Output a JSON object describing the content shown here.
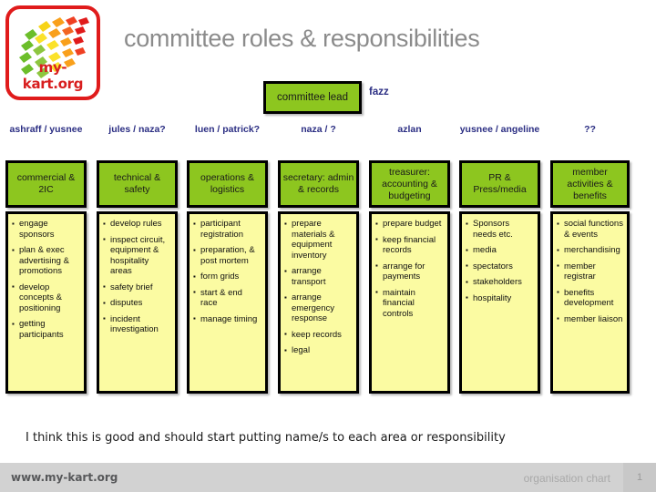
{
  "brand": {
    "logo_text": "my-kart.org",
    "logo_icon": "checkered-flag-icon",
    "border_color": "#e01b1b"
  },
  "header": {
    "title": "committee roles & responsibilities",
    "title_color": "#8b8b8b"
  },
  "lead": {
    "label": "committee lead",
    "owner": "fazz",
    "box_color": "#8dc61f"
  },
  "colors": {
    "role_green": "#8dc61f",
    "tasks_yellow": "#fbfba2",
    "name_blue": "#2b2e83",
    "footer_gray": "#d2d2d2"
  },
  "columns": [
    {
      "owner": "ashraff / yusnee",
      "role": "commercial & 2IC",
      "tasks": [
        "engage sponsors",
        "plan & exec advertising & promotions",
        "develop concepts & positioning",
        "getting participants"
      ]
    },
    {
      "owner": "jules / naza?",
      "role": "technical & safety",
      "tasks": [
        "develop rules",
        "inspect circuit, equipment & hospitality areas",
        "safety brief",
        "disputes",
        "incident investigation"
      ]
    },
    {
      "owner": "luen / patrick?",
      "role": "operations & logistics",
      "tasks": [
        "participant registration",
        "preparation, & post mortem",
        "form grids",
        "start & end race",
        "manage timing"
      ]
    },
    {
      "owner": "naza / ?",
      "role": "secretary: admin & records",
      "tasks": [
        "prepare materials & equipment inventory",
        "arrange transport",
        "arrange emergency response",
        "keep records",
        "legal"
      ]
    },
    {
      "owner": "azlan",
      "role": "treasurer: accounting & budgeting",
      "tasks": [
        "prepare budget",
        "keep financial records",
        "arrange for payments",
        "maintain financial controls"
      ]
    },
    {
      "owner": "yusnee / angeline",
      "role": "PR & Press/media",
      "tasks": [
        "Sponsors needs etc.",
        "media",
        "spectators",
        "stakeholders",
        "hospitality"
      ]
    },
    {
      "owner": "??",
      "role": "member activities & benefits",
      "tasks": [
        "social functions & events",
        "merchandising",
        "member registrar",
        "benefits development",
        "member liaison"
      ]
    }
  ],
  "note": "I think this is good and should start putting name/s to each area or responsibility",
  "footer": {
    "url": "www.my-kart.org",
    "section": "organisation chart",
    "page": "1"
  }
}
